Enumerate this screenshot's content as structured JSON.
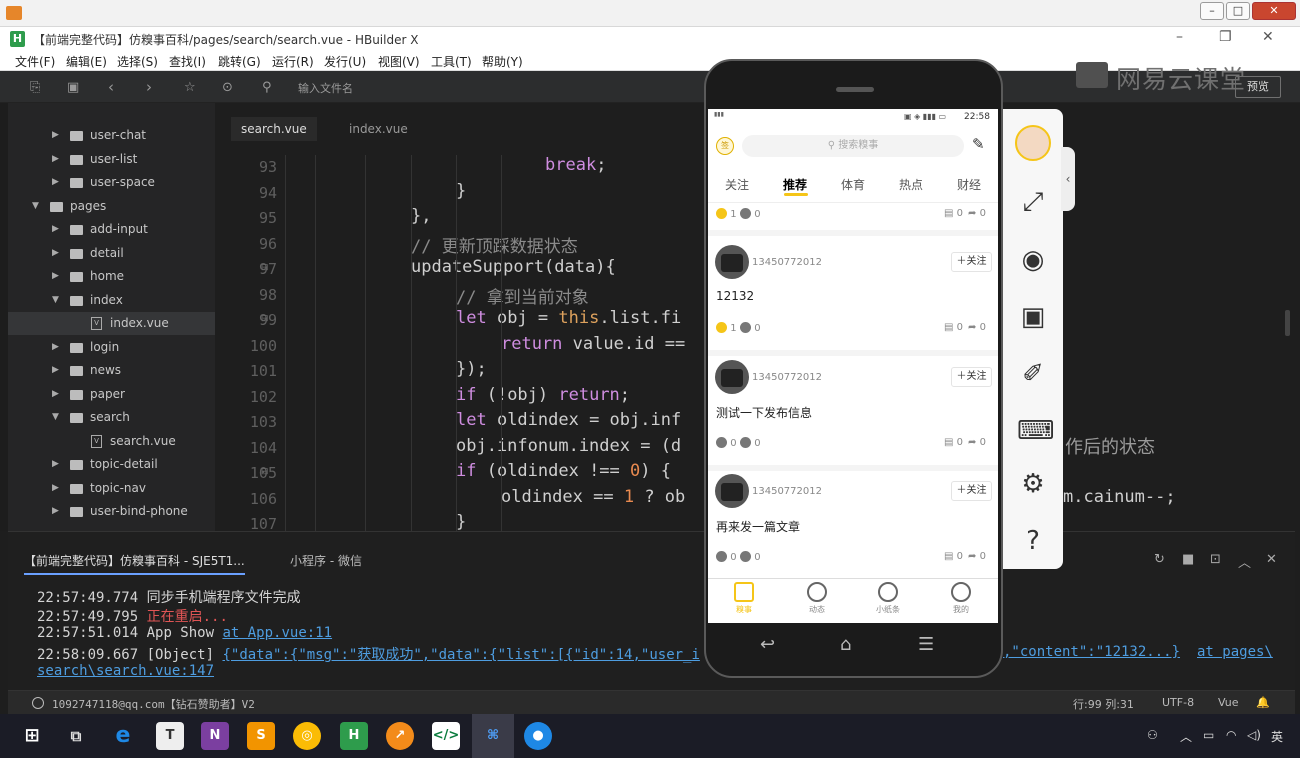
{
  "outer_window": {
    "title": ""
  },
  "app": {
    "title": "【前端完整代码】仿糗事百科/pages/search/search.vue - HBuilder X",
    "logo": "H"
  },
  "menu": [
    "文件(F)",
    "编辑(E)",
    "选择(S)",
    "查找(I)",
    "跳转(G)",
    "运行(R)",
    "发行(U)",
    "视图(V)",
    "工具(T)",
    "帮助(Y)"
  ],
  "toolbar": {
    "file_search_placeholder": "输入文件名",
    "preview_label": "预览"
  },
  "watermark": "网易云课堂",
  "sidebar": {
    "items": [
      {
        "label": "user-chat",
        "type": "folder",
        "depth": 2,
        "expanded": false
      },
      {
        "label": "user-list",
        "type": "folder",
        "depth": 2,
        "expanded": false
      },
      {
        "label": "user-space",
        "type": "folder",
        "depth": 2,
        "expanded": false
      },
      {
        "label": "pages",
        "type": "folder",
        "depth": 1,
        "expanded": true
      },
      {
        "label": "add-input",
        "type": "folder",
        "depth": 2,
        "expanded": false
      },
      {
        "label": "detail",
        "type": "folder",
        "depth": 2,
        "expanded": false
      },
      {
        "label": "home",
        "type": "folder",
        "depth": 2,
        "expanded": false
      },
      {
        "label": "index",
        "type": "folder",
        "depth": 2,
        "expanded": true
      },
      {
        "label": "index.vue",
        "type": "file",
        "depth": 3,
        "selected": true
      },
      {
        "label": "login",
        "type": "folder",
        "depth": 2,
        "expanded": false
      },
      {
        "label": "news",
        "type": "folder",
        "depth": 2,
        "expanded": false
      },
      {
        "label": "paper",
        "type": "folder",
        "depth": 2,
        "expanded": false
      },
      {
        "label": "search",
        "type": "folder",
        "depth": 2,
        "expanded": true
      },
      {
        "label": "search.vue",
        "type": "file",
        "depth": 3
      },
      {
        "label": "topic-detail",
        "type": "folder",
        "depth": 2,
        "expanded": false
      },
      {
        "label": "topic-nav",
        "type": "folder",
        "depth": 2,
        "expanded": false
      },
      {
        "label": "user-bind-phone",
        "type": "folder",
        "depth": 2,
        "expanded": false
      }
    ]
  },
  "editor": {
    "tabs": [
      {
        "label": "search.vue",
        "active": true
      },
      {
        "label": "index.vue",
        "active": false
      }
    ],
    "lines": [
      {
        "n": "93",
        "text": "break;",
        "fold": false
      },
      {
        "n": "94",
        "text": "}",
        "fold": false
      },
      {
        "n": "95",
        "text": "},",
        "fold": false
      },
      {
        "n": "96",
        "text": "// 更新顶踩数据状态",
        "fold": false
      },
      {
        "n": "97",
        "text": "updateSupport(data){",
        "fold": true
      },
      {
        "n": "98",
        "text": "// 拿到当前对象",
        "fold": false
      },
      {
        "n": "99",
        "text": "let obj = this.list.fi",
        "fold": true
      },
      {
        "n": "100",
        "text": "return value.id ==",
        "fold": false
      },
      {
        "n": "101",
        "text": "});",
        "fold": false
      },
      {
        "n": "102",
        "text": "if (!obj) return;",
        "fold": false
      },
      {
        "n": "103",
        "text": "let oldindex = obj.inf",
        "fold": false
      },
      {
        "n": "104",
        "text": "obj.infonum.index = (d",
        "fold": false
      },
      {
        "n": "105",
        "text": "if (oldindex !== 0) {",
        "fold": true
      },
      {
        "n": "106",
        "text": "oldindex == 1 ? ob",
        "fold": false
      },
      {
        "n": "107",
        "text": "}",
        "fold": false
      }
    ],
    "overflow_text_1": "作后的状态",
    "overflow_text_2": "m.cainum--;"
  },
  "console": {
    "tabs": [
      {
        "label": "【前端完整代码】仿糗事百科 - SJE5T1...",
        "active": true
      },
      {
        "label": "小程序 - 微信",
        "active": false
      }
    ],
    "lines": [
      {
        "time": "22:57:49.774",
        "text": "同步手机端程序文件完成",
        "link": ""
      },
      {
        "time": "22:57:49.795",
        "text": "正在重启...",
        "link": ""
      },
      {
        "time": "22:57:51.014",
        "text": "App Show",
        "link": "at App.vue:11"
      },
      {
        "time": "22:58:09.667",
        "text": "[Object]",
        "link": "{\"data\":{\"msg\":\"获取成功\",\"data\":{\"list\":[{\"id\":14,\"user_i"
      },
      {
        "time": "",
        "text": "",
        "link": ",\"content\":\"12132...}"
      },
      {
        "time": "",
        "text": "",
        "link": "at pages\\"
      },
      {
        "time": "",
        "text": "",
        "link": "search\\search.vue:147"
      }
    ]
  },
  "statusbar": {
    "user": "1092747118@qq.com【钻石赞助者】V2",
    "position": "行:99 列:31",
    "encoding": "UTF-8",
    "language": "Vue"
  },
  "phone": {
    "time": "22:58",
    "search_placeholder": "搜索糗事",
    "tabs": [
      "关注",
      "推荐",
      "体育",
      "热点",
      "财经"
    ],
    "active_tab": "推荐",
    "first_meta": {
      "like": "1",
      "dislike": "0",
      "comments": "0",
      "shares": "0"
    },
    "posts": [
      {
        "username": "13450772012",
        "follow": "关注",
        "content": "12132",
        "like": "1",
        "dislike": "0",
        "comments": "0",
        "shares": "0"
      },
      {
        "username": "13450772012",
        "follow": "关注",
        "content": "测试一下发布信息",
        "like": "0",
        "dislike": "0",
        "comments": "0",
        "shares": "0"
      },
      {
        "username": "13450772012",
        "follow": "关注",
        "content": "再来发一篇文章",
        "like": "0",
        "dislike": "0",
        "comments": "0",
        "shares": "0"
      }
    ],
    "bottom_nav": [
      "糗事",
      "动态",
      "小纸条",
      "我的"
    ]
  },
  "taskbar": {
    "lang": "英"
  },
  "colors": {
    "accent": "#f5c518",
    "link": "#4e9de0",
    "error": "#e05555"
  }
}
